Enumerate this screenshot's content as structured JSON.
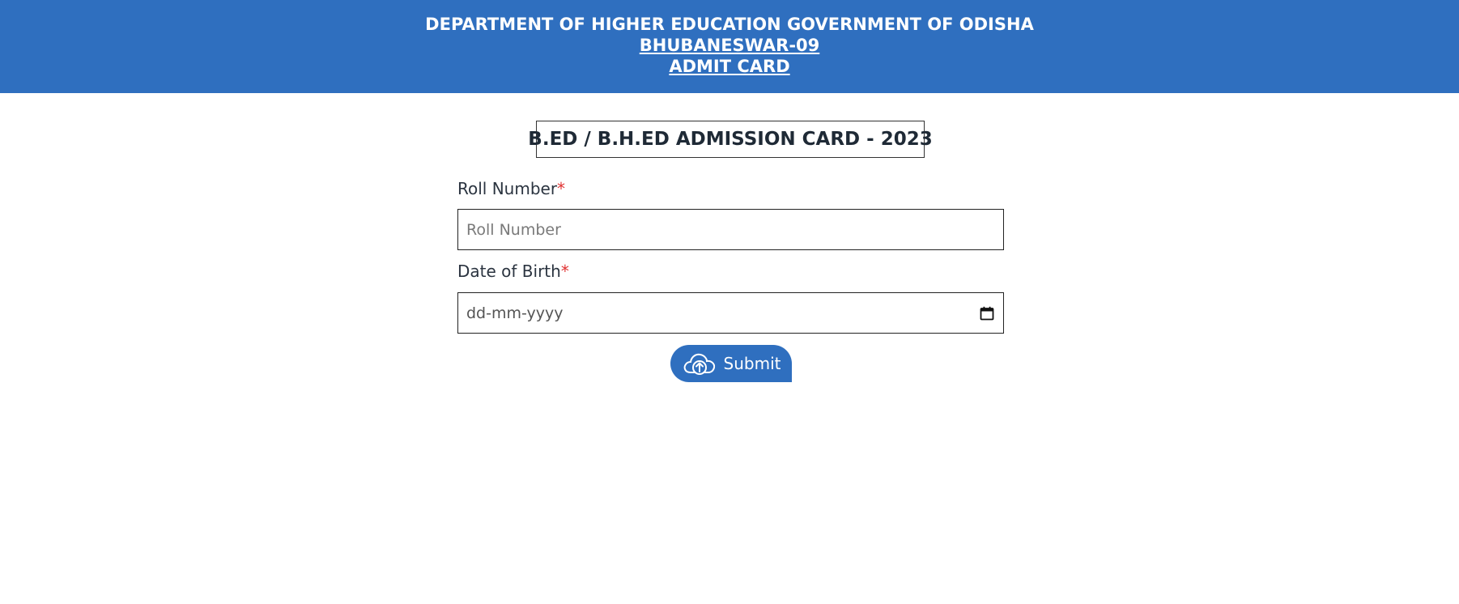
{
  "header": {
    "department": "DEPARTMENT OF HIGHER EDUCATION GOVERNMENT OF ODISHA",
    "city": "BHUBANESWAR-09",
    "card_title": "ADMIT CARD",
    "bg_color": "#2f6fbf"
  },
  "form": {
    "title": "B.ED / B.H.ED ADMISSION CARD - 2023",
    "roll_number": {
      "label": "Roll Number",
      "required_mark": "*",
      "placeholder": "Roll Number",
      "value": ""
    },
    "date_of_birth": {
      "label": "Date of Birth",
      "required_mark": "*",
      "placeholder": "dd-mm-yyyy",
      "icon": "calendar-icon"
    },
    "submit": {
      "label": "Submit",
      "icon": "cloud-upload-icon",
      "color": "#2f6fbf"
    }
  }
}
